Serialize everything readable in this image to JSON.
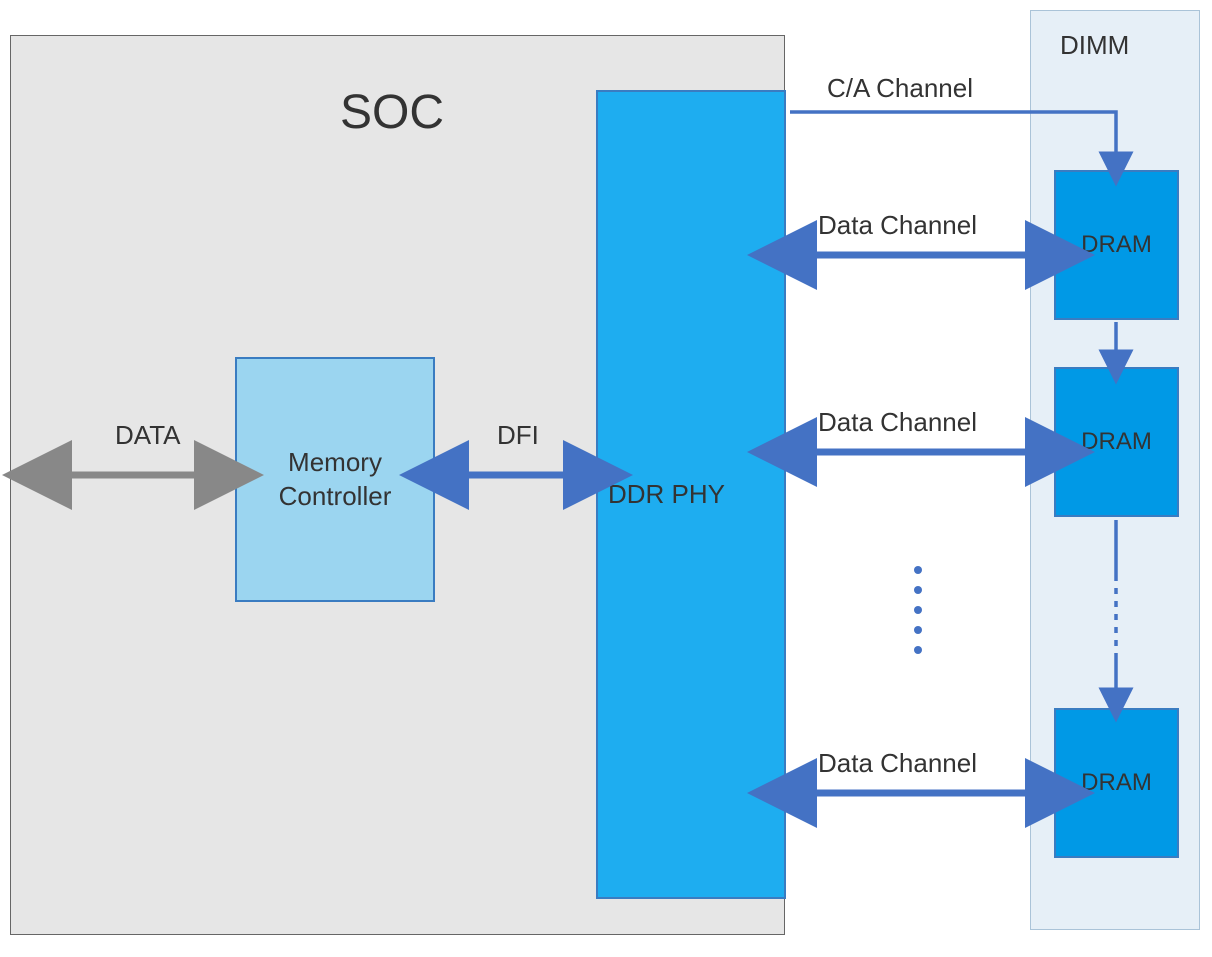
{
  "soc": {
    "title": "SOC",
    "memory_controller_label": "Memory\nController",
    "ddr_phy_label": "DDR PHY"
  },
  "dimm": {
    "title": "DIMM",
    "dram_label": "DRAM"
  },
  "labels": {
    "data": "DATA",
    "dfi": "DFI",
    "ca_channel": "C/A Channel",
    "data_channel": "Data Channel"
  },
  "colors": {
    "soc_bg": "#e6e6e6",
    "mem_ctrl_bg": "#9bd5f0",
    "ddr_phy_bg": "#1eadf0",
    "dimm_bg": "#e6eff7",
    "dram_bg": "#0099e6",
    "arrow_blue": "#4472c4",
    "arrow_gray": "#888"
  }
}
